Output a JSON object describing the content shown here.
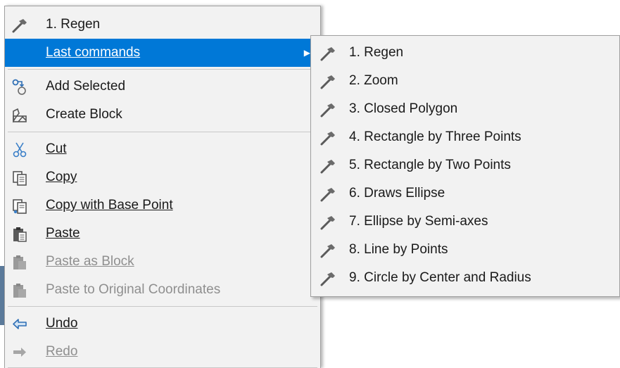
{
  "main_menu": {
    "regen_label": "1. Regen",
    "last_commands_label": "Last commands",
    "add_selected_label": "Add Selected",
    "create_block_label": "Create Block",
    "cut_label": "Cut",
    "copy_label": "Copy",
    "copy_base_point_label": "Copy with Base Point",
    "paste_label": "Paste",
    "paste_as_block_label": "Paste as Block",
    "paste_original_label": "Paste to Original Coordinates",
    "undo_label": "Undo",
    "redo_label": "Redo"
  },
  "submenu": {
    "items": [
      {
        "label": "1. Regen"
      },
      {
        "label": "2. Zoom"
      },
      {
        "label": "3. Closed Polygon"
      },
      {
        "label": "4. Rectangle by Three Points"
      },
      {
        "label": "5. Rectangle by Two Points"
      },
      {
        "label": "6. Draws Ellipse"
      },
      {
        "label": "7. Ellipse by Semi-axes"
      },
      {
        "label": "8. Line by Points"
      },
      {
        "label": "9. Circle by Center and Radius"
      }
    ]
  },
  "colors": {
    "highlight": "#0078d7",
    "menu_background": "#f2f2f2",
    "disabled_text": "#8f8f8f"
  },
  "icons": [
    "hammer-icon",
    "chevron-right-icon",
    "add-selected-icon",
    "create-block-icon",
    "scissors-icon",
    "copy-icon",
    "copy-base-point-icon",
    "paste-icon",
    "paste-as-block-icon",
    "paste-original-icon",
    "undo-icon",
    "redo-icon"
  ]
}
